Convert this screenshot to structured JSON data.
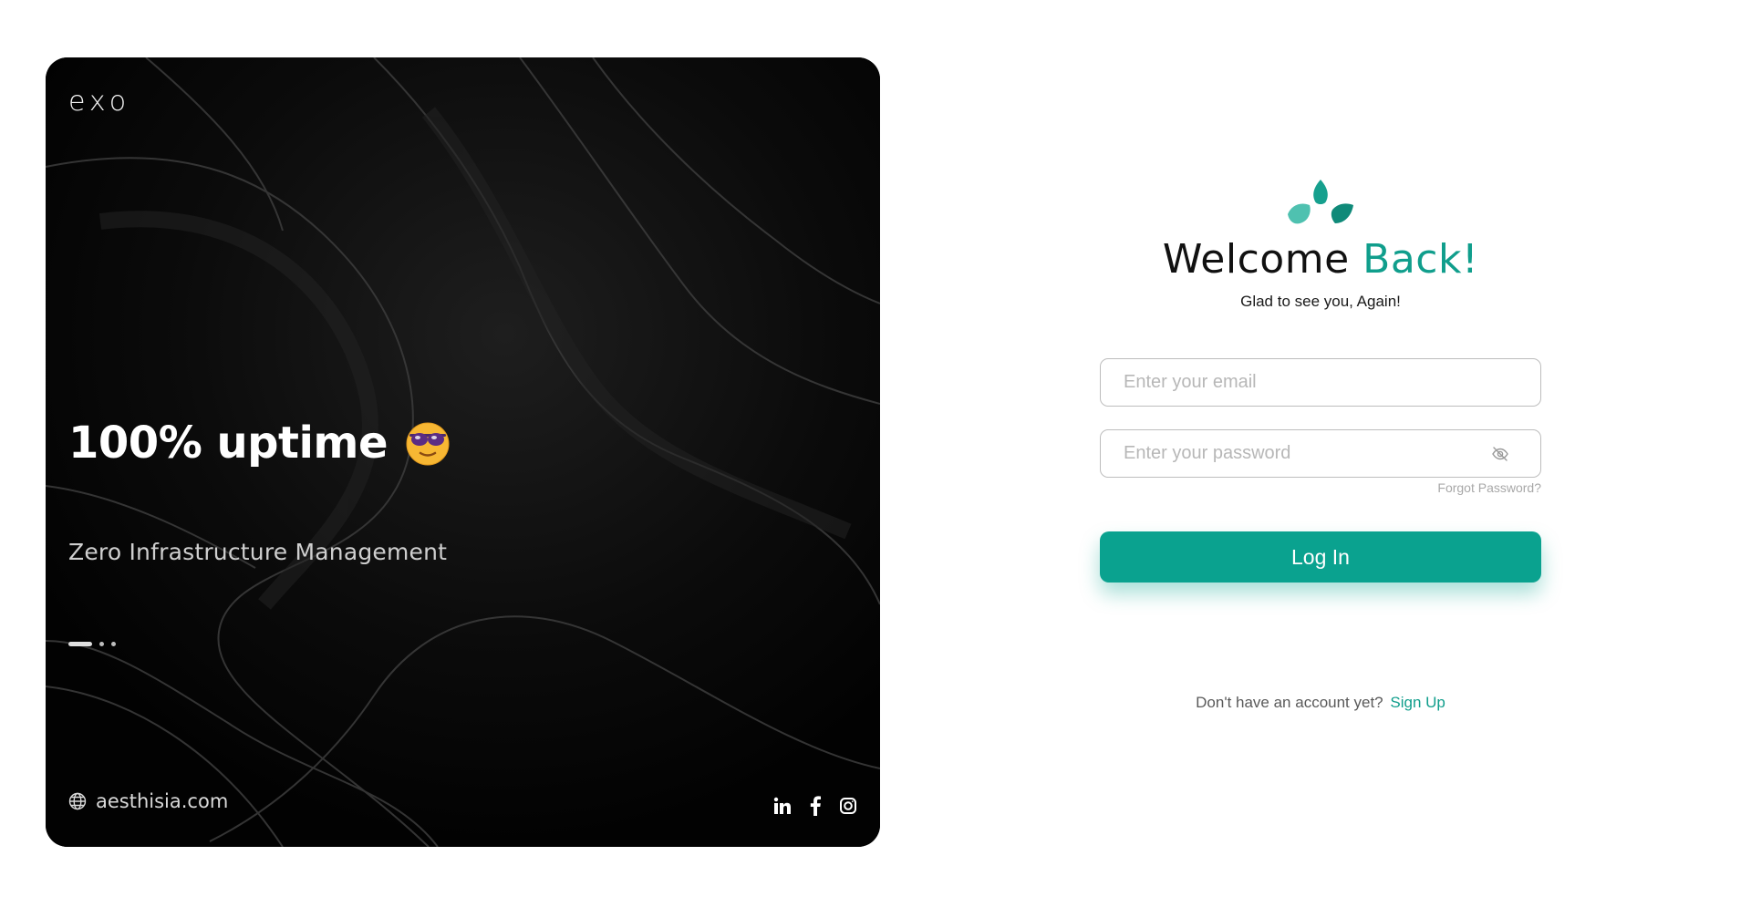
{
  "hero": {
    "brand": "exo",
    "headline": "100% uptime",
    "headline_emoji": "smiling-face-with-sunglasses",
    "subtitle": "Zero Infrastructure Management",
    "carousel": {
      "count": 3,
      "active_index": 0
    },
    "site_link": "aesthisia.com",
    "site_icon": "globe-icon",
    "social_icons": [
      "linkedin-icon",
      "facebook-icon",
      "instagram-icon"
    ]
  },
  "login": {
    "logo_icon": "leaf-logo-icon",
    "title_part1": "Welcome",
    "title_part2": "Back!",
    "tagline": "Glad to see you, Again!",
    "email_placeholder": "Enter your email",
    "password_placeholder": "Enter your password",
    "password_toggle_icon": "eye-off-icon",
    "forgot_link": "Forgot Password?",
    "login_button": "Log In",
    "signup_prompt": "Don't have an account yet?",
    "signup_link": "Sign Up"
  },
  "colors": {
    "accent": "#0aa28f",
    "accent_text": "#109e8c",
    "hero_bg": "#050505"
  }
}
